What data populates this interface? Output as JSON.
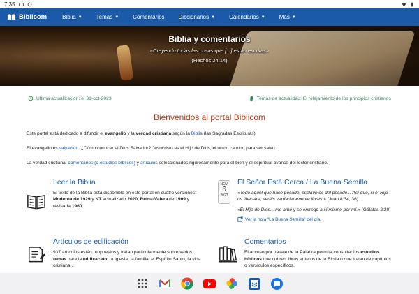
{
  "status": {
    "time": "7:35"
  },
  "brand": {
    "name": "Biblicom"
  },
  "nav": [
    {
      "label": "Biblia"
    },
    {
      "label": "Temas"
    },
    {
      "label": "Comentarios"
    },
    {
      "label": "Diccionarios"
    },
    {
      "label": "Calendarios"
    },
    {
      "label": "Más"
    }
  ],
  "hero": {
    "title": "Biblia y comentarios",
    "subtitle": "«Creyendo todas las cosas que [...] están escritas»",
    "reference": "(Hechos 24:14)"
  },
  "info": {
    "last_update": "Última actualización: el 31-oct-2023",
    "topical": "Temas de actualidad: El relajamiento de los principios cristianos"
  },
  "welcome": "Bienvenidos al portal Biblicom",
  "intro": {
    "p1_a": "Este portal está dedicado a difundir el ",
    "p1_b": "evangelio",
    "p1_c": " y la ",
    "p1_d": "verdad cristiana",
    "p1_e": " según la ",
    "p1_f": "Biblia",
    "p1_g": " (las Sagradas Escrituras).",
    "p2_a": "El evangelio es ",
    "p2_b": "salvación",
    "p2_c": ". ¿Cómo conocer al Dios Salvador? Jesucristo es el Hijo de Dios, el único camino para ser salvo.",
    "p3_a": "La verdad cristiana: ",
    "p3_b": "comentarios (o estudios bíblicos)",
    "p3_c": " y ",
    "p3_d": "artículos",
    "p3_e": " seleccionados rigurosamente para el bien y el espiritual avance del lector cristiano."
  },
  "cards": {
    "leer": {
      "title": "Leer la Biblia",
      "t1": "El texto de la Biblia está disponible en este portal en cuatro versiones: ",
      "b1": "Moderna de 1929",
      "t2": " y ",
      "b2": "NT",
      "t3": " actualizado ",
      "b3": "2020",
      "t4": ", ",
      "b4": "Reina-Valera",
      "t5": " de ",
      "b5": "1909",
      "t6": " y revisada ",
      "b6": "1960",
      "t7": "."
    },
    "senor": {
      "title": "El Señor Está Cerca / La Buena Semilla",
      "cal_month": "NOV",
      "cal_day": "6",
      "cal_year": "2023",
      "q1": "«Todo aquel que hace pecado, esclavo es del pecado... Así que, si el Hijo os libertare, seréis verdaderamente libres.»",
      "q1_ref": " (Juan 8:34, 36)",
      "q2": "«El Hijo de Dios... me amó y se entregó a sí mismo por mí.»",
      "q2_ref": " (Gálatas 2:20)",
      "link": "Ver la hoja \"La Buena Semilla\" del día."
    },
    "articulos": {
      "title": "Artículos de edificación",
      "t1": "937 artículos están propuestos y tratan particularmente sobre varios ",
      "b1": "temas",
      "t2": " para la ",
      "b2": "edificación",
      "t3": ": la Iglesia, la familia, el Espíritu Santo, la vida cristiana..."
    },
    "comentarios": {
      "title": "Comentarios",
      "t1": "El acceso por pasaje de la Palabra permite consultar los ",
      "b1": "estudios bíblicos",
      "t2": " que cubren libros enteros de la Biblia o que tratan de capítulos o versículos específicos."
    }
  },
  "dock": [
    {
      "icon": "apps-grid-icon"
    },
    {
      "icon": "gmail-icon"
    },
    {
      "icon": "chrome-icon"
    },
    {
      "icon": "youtube-icon"
    },
    {
      "icon": "photos-icon"
    },
    {
      "icon": "biblicom-app-icon"
    },
    {
      "icon": "messages-icon"
    }
  ],
  "colors": {
    "navbar": "#1a5aa8",
    "accent_red": "#b03a1a",
    "green": "#3a8a5a"
  }
}
